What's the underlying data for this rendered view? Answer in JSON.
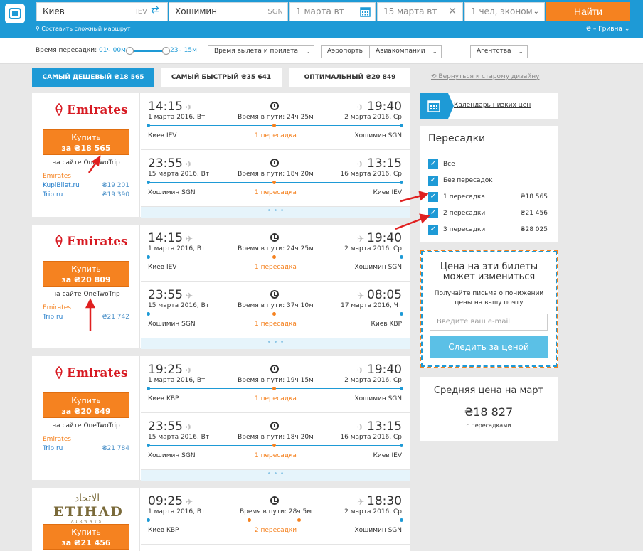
{
  "search": {
    "from": "Киев",
    "from_code": "IEV",
    "to": "Хошимин",
    "to_code": "SGN",
    "date1": "1 марта вт",
    "date2": "15 марта вт",
    "pax": "1 чел, эконом",
    "find": "Найти",
    "complex": "Составить сложный маршрут",
    "currency": "₴ – Гривна"
  },
  "filters": {
    "label": "Время пересадки:",
    "min": "01ч 00м",
    "max": "23ч 15м",
    "dropdowns": [
      "Время вылета и прилета",
      "Аэропорты",
      "Авиакомпании",
      "Агентства"
    ]
  },
  "tabs": [
    "САМЫЙ ДЕШЕВЫЙ ₴18 565",
    "САМЫЙ БЫСТРЫЙ ₴35 641",
    "ОПТИМАЛЬНЫЙ ₴20 849"
  ],
  "old_design": "Вернуться к старому дизайну",
  "cards": [
    {
      "airline": "Emirates",
      "buy": "Купить",
      "price": "за ₴18 565",
      "site": "на сайте OneTwoTrip",
      "prov_head": "Emirates",
      "providers": [
        {
          "name": "KupiBilet.ru",
          "price": "₴19 201"
        },
        {
          "name": "Trip.ru",
          "price": "₴19 390"
        }
      ],
      "segs": [
        {
          "dep": "14:15",
          "depdate": "1 марта 2016, Вт",
          "arr": "19:40",
          "arrdate": "2 марта 2016, Ср",
          "dur": "Время в пути: 24ч 25м",
          "from": "Киев IEV",
          "to": "Хошимин SGN",
          "stops": "1 пересадка"
        },
        {
          "dep": "23:55",
          "depdate": "15 марта 2016, Вт",
          "arr": "13:15",
          "arrdate": "16 марта 2016, Ср",
          "dur": "Время в пути: 18ч 20м",
          "from": "Хошимин SGN",
          "to": "Киев IEV",
          "stops": "1 пересадка"
        }
      ]
    },
    {
      "airline": "Emirates",
      "buy": "Купить",
      "price": "за ₴20 809",
      "site": "на сайте OneTwoTrip",
      "prov_head": "Emirates",
      "providers": [
        {
          "name": "Trip.ru",
          "price": "₴21 742"
        }
      ],
      "segs": [
        {
          "dep": "14:15",
          "depdate": "1 марта 2016, Вт",
          "arr": "19:40",
          "arrdate": "2 марта 2016, Ср",
          "dur": "Время в пути: 24ч 25м",
          "from": "Киев IEV",
          "to": "Хошимин SGN",
          "stops": "1 пересадка"
        },
        {
          "dep": "23:55",
          "depdate": "15 марта 2016, Вт",
          "arr": "08:05",
          "arrdate": "17 марта 2016, Чт",
          "dur": "Время в пути: 37ч 10м",
          "from": "Хошимин SGN",
          "to": "Киев KBP",
          "stops": "1 пересадка"
        }
      ]
    },
    {
      "airline": "Emirates",
      "buy": "Купить",
      "price": "за ₴20 849",
      "site": "на сайте OneTwoTrip",
      "prov_head": "Emirates",
      "providers": [
        {
          "name": "Trip.ru",
          "price": "₴21 784"
        }
      ],
      "segs": [
        {
          "dep": "19:25",
          "depdate": "1 марта 2016, Вт",
          "arr": "19:40",
          "arrdate": "2 марта 2016, Ср",
          "dur": "Время в пути: 19ч 15м",
          "from": "Киев KBP",
          "to": "Хошимин SGN",
          "stops": "1 пересадка"
        },
        {
          "dep": "23:55",
          "depdate": "15 марта 2016, Вт",
          "arr": "13:15",
          "arrdate": "16 марта 2016, Ср",
          "dur": "Время в пути: 18ч 20м",
          "from": "Хошимин SGN",
          "to": "Киев IEV",
          "stops": "1 пересадка"
        }
      ]
    },
    {
      "airline_ar": "الاتحاد",
      "airline_en": "ETIHAD",
      "airline_sub": "AIRWAYS",
      "buy": "Купить",
      "price": "за ₴21 456",
      "segs": [
        {
          "dep": "09:25",
          "depdate": "1 марта 2016, Вт",
          "arr": "18:30",
          "arrdate": "2 марта 2016, Ср",
          "dur": "Время в пути: 28ч 5м",
          "from": "Киев KBP",
          "to": "Хошимин SGN",
          "stops": "2 пересадки"
        }
      ]
    }
  ],
  "calendar": "Календарь низких цен",
  "transfers": {
    "title": "Пересадки",
    "items": [
      {
        "label": "Все",
        "price": ""
      },
      {
        "label": "Без пересадок",
        "price": ""
      },
      {
        "label": "1 пересадка",
        "price": "₴18 565"
      },
      {
        "label": "2 пересадки",
        "price": "₴21 456"
      },
      {
        "label": "3 пересадки",
        "price": "₴28 025"
      }
    ]
  },
  "subscribe": {
    "h1": "Цена на эти билеты",
    "h2": "может измениться",
    "p1": "Получайте письма о понижении",
    "p2": "цены на вашу почту",
    "placeholder": "Введите ваш e-mail",
    "button": "Следить за ценой"
  },
  "avg": {
    "title": "Средняя цена на март",
    "price": "₴18 827",
    "sub": "с пересадками"
  },
  "colors": {
    "blue": "#1e9ad6",
    "orange": "#f58220",
    "red": "#e02020"
  }
}
